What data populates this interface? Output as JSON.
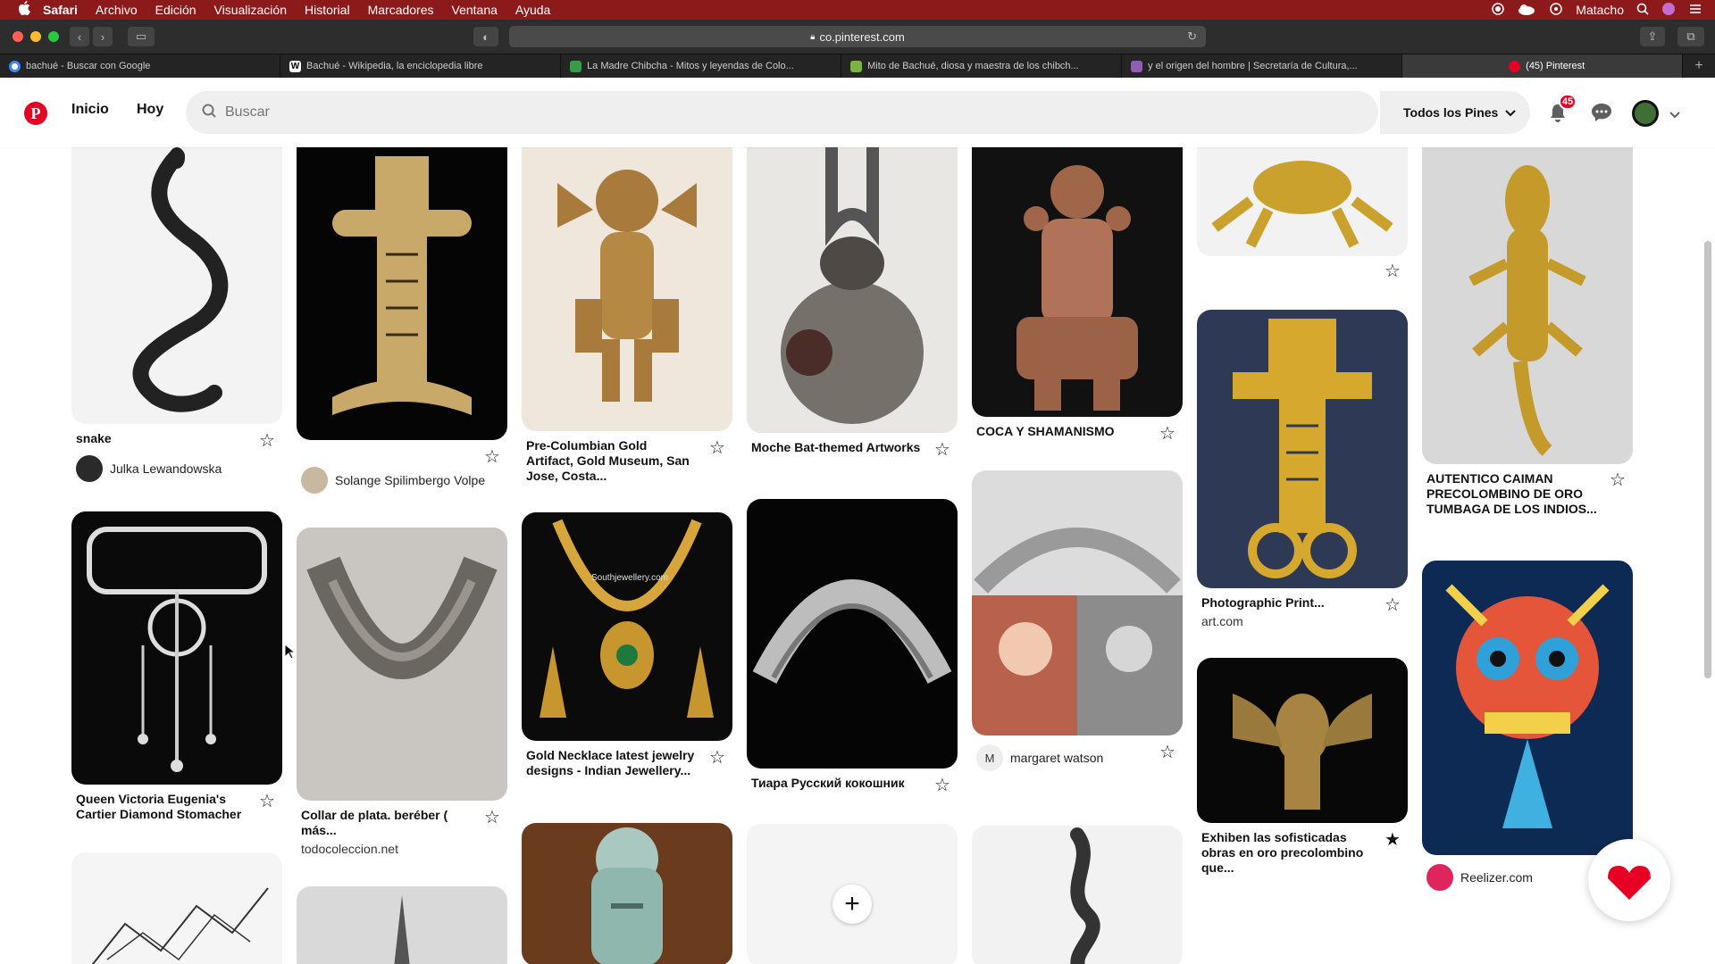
{
  "menubar": {
    "app": "Safari",
    "items": [
      "Archivo",
      "Edición",
      "Visualización",
      "Historial",
      "Marcadores",
      "Ventana",
      "Ayuda"
    ],
    "user": "Matacho"
  },
  "browser": {
    "url": "co.pinterest.com",
    "tabs": [
      {
        "label": "bachué - Buscar con Google",
        "color": "#4285f4"
      },
      {
        "label": "Bachué - Wikipedia, la enciclopedia libre",
        "color": "#ffffff"
      },
      {
        "label": "La Madre Chibcha - Mitos y leyendas de Colo...",
        "color": "#3a9a4a"
      },
      {
        "label": "Mito de Bachué, diosa y maestra de los chibch...",
        "color": "#7cb342"
      },
      {
        "label": "y el origen del hombre | Secretaría de Cultura,...",
        "color": "#8e5fb0"
      },
      {
        "label": "(45) Pinterest",
        "color": "#e60023"
      }
    ]
  },
  "header": {
    "logo": "P",
    "home": "Inicio",
    "today": "Hoy",
    "search_placeholder": "Buscar",
    "filter": "Todos los Pines",
    "notifications": "45"
  },
  "pins": [
    {
      "title": "snake",
      "user": "Julka Lewandowska"
    },
    {
      "title": "Queen Victoria Eugenia's Cartier Diamond Stomacher"
    },
    {
      "user": "Solange Spilimbergo Volpe"
    },
    {
      "title": "Collar de plata. beréber ( más...",
      "source": "todocoleccion.net"
    },
    {
      "title": "Pre-Columbian Gold Artifact, Gold Museum, San Jose, Costa..."
    },
    {
      "title": "Gold Necklace latest jewelry designs - Indian Jewellery...",
      "watermark": "Southjewellery.com"
    },
    {
      "title": "Moche Bat-themed Artworks"
    },
    {
      "title": "Тиара Русский кокошник"
    },
    {
      "title": "COCA Y SHAMANISMO"
    },
    {
      "user": "margaret watson",
      "initial": "M"
    },
    {
      "title": "Photographic Print...",
      "source": "art.com"
    },
    {
      "title": "Exhiben las sofisticadas obras en oro precolombino que..."
    },
    {
      "title": "AUTENTICO CAIMAN PRECOLOMBINO DE ORO TUMBAGA DE LOS INDIOS..."
    },
    {
      "user": "Reelizer.com"
    }
  ],
  "icons": {
    "star": "☆",
    "star_filled": "★",
    "plus": "+"
  }
}
